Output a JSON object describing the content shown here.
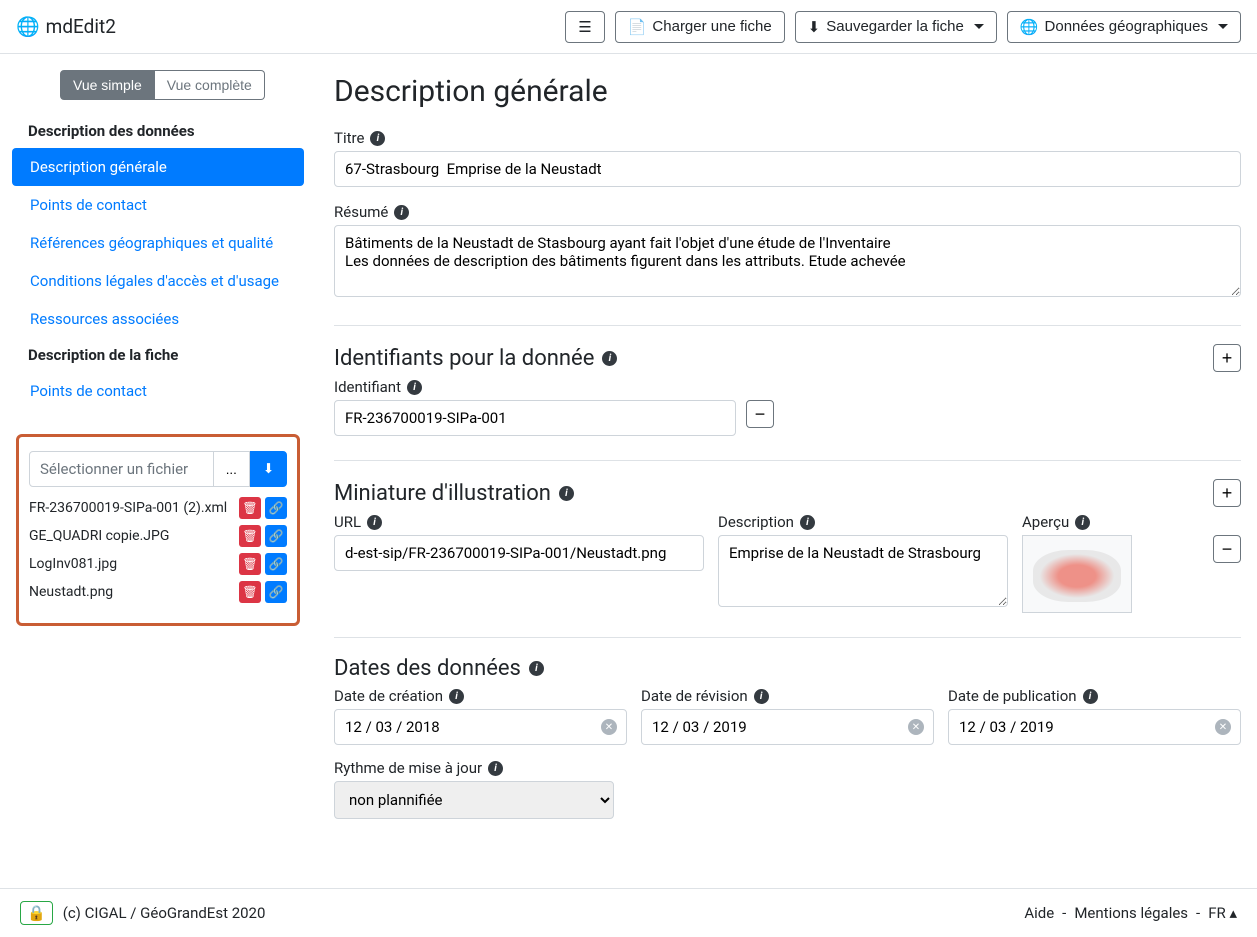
{
  "app": {
    "name": "mdEdit2"
  },
  "topbar": {
    "btn_load": "Charger une fiche",
    "btn_save": "Sauvegarder la fiche",
    "btn_geo": "Données géographiques"
  },
  "sidebar": {
    "view_simple": "Vue simple",
    "view_full": "Vue complète",
    "section1": "Description des données",
    "items1": [
      "Description générale",
      "Points de contact",
      "Références géographiques et qualité",
      "Conditions légales d'accès et d'usage",
      "Ressources associées"
    ],
    "section2": "Description de la fiche",
    "items2": [
      "Points de contact"
    ]
  },
  "filebox": {
    "placeholder": "Sélectionner un fichier",
    "browse": "...",
    "files": [
      "FR-236700019-SIPa-001 (2).xml",
      "GE_QUADRI copie.JPG",
      "LogInv081.jpg",
      "Neustadt.png"
    ]
  },
  "content": {
    "title": "Description générale",
    "title_label": "Titre",
    "title_value": "67-Strasbourg  Emprise de la Neustadt",
    "summary_label": "Résumé",
    "summary_value": "Bâtiments de la Neustadt de Stasbourg ayant fait l'objet d'une étude de l'Inventaire\nLes données de description des bâtiments figurent dans les attributs. Etude achevée",
    "ids_section": "Identifiants pour la donnée",
    "id_label": "Identifiant",
    "id_value": "FR-236700019-SIPa-001",
    "thumb_section": "Miniature d'illustration",
    "url_label": "URL",
    "url_value": "d-est-sip/FR-236700019-SIPa-001/Neustadt.png",
    "desc_label": "Description",
    "desc_value": "Emprise de la Neustadt de Strasbourg",
    "preview_label": "Aperçu",
    "dates_section": "Dates des données",
    "date_creation_label": "Date de création",
    "date_creation": "12 / 03 / 2018",
    "date_revision_label": "Date de révision",
    "date_revision": "12 / 03 / 2019",
    "date_pub_label": "Date de publication",
    "date_pub": "12 / 03 / 2019",
    "rhythm_label": "Rythme de mise à jour",
    "rhythm_value": "non plannifiée"
  },
  "footer": {
    "copyright": "(c) CIGAL / GéoGrandEst 2020",
    "help": "Aide",
    "legal": "Mentions légales",
    "lang": "FR"
  }
}
